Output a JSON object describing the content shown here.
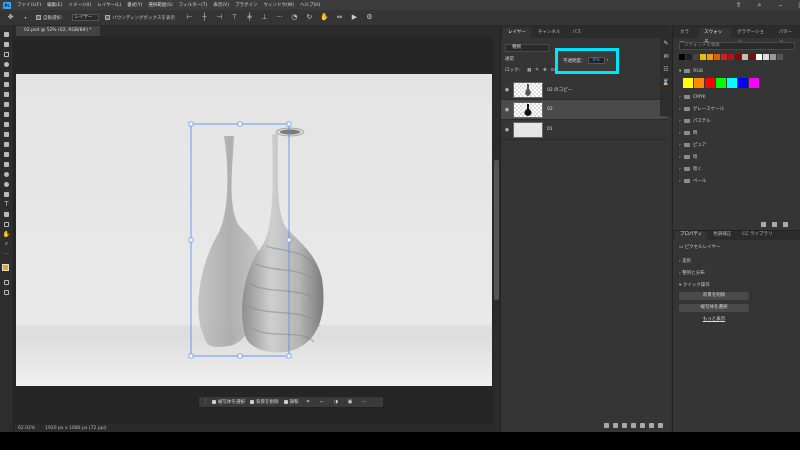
{
  "menubar": {
    "logo": "Ps",
    "items": [
      "ファイル(F)",
      "編集(E)",
      "イメージ(I)",
      "レイヤー(L)",
      "書式(Y)",
      "選択範囲(S)",
      "フィルター(T)",
      "表示(V)",
      "プラグイン",
      "ウィンドウ(W)",
      "ヘルプ(H)"
    ]
  },
  "options": {
    "auto_select_label": "自動選択：",
    "auto_select_target": "レイヤー",
    "bbox_label": "バウンディングボックスを表示"
  },
  "document": {
    "tab_label": "02.psd @ 52% (02, RGB/8#) *",
    "zoom": "62.02%",
    "size_info": "1920 px x 1080 px (72 ppi)"
  },
  "context_bar": {
    "select_subject": "被写体を選択",
    "remove_bg": "背景を削除",
    "adjust": "調和"
  },
  "layers_panel": {
    "tabs": [
      "レイヤー",
      "チャンネル",
      "パス"
    ],
    "kind_label": "種類",
    "blend_mode": "通常",
    "lock_label": "ロック：",
    "opacity_label": "不透明度：",
    "opacity_value": "0%",
    "layers": [
      {
        "name": "02 のコピー",
        "selected": false
      },
      {
        "name": "02",
        "selected": true
      },
      {
        "name": "01",
        "selected": false
      }
    ]
  },
  "swatches_panel": {
    "tabs": [
      "カラー",
      "スウォッチ",
      "グラデーション",
      "パターン"
    ],
    "search_placeholder": "スウォッチを検索",
    "recent_colors": [
      "#000000",
      "#222222",
      "#444444",
      "#f0c000",
      "#f0a000",
      "#e06000",
      "#d02020",
      "#b01818",
      "#900000",
      "#c0c0c0",
      "#7a1010",
      "#ffffff",
      "#dddddd",
      "#999999",
      "#555555"
    ],
    "groups": [
      "RGB",
      "CMYK",
      "グレースケール",
      "パステル",
      "明",
      "ピュア",
      "暗",
      "暗く",
      "ペール"
    ],
    "rgb_colors": [
      "#ffff00",
      "#ff8800",
      "#ff0000",
      "#00ff00",
      "#00ffff",
      "#0000ff",
      "#ff00ff"
    ]
  },
  "properties_panel": {
    "tabs": [
      "プロパティ",
      "色調補正",
      "CC ライブラリ"
    ],
    "layer_type": "ピクセルレイヤー",
    "transform": "変形",
    "align": "整列と分布",
    "quick_actions": "クイック操作",
    "btn_remove_bg": "背景を削除",
    "btn_select_subject": "被写体を選択",
    "link_more": "もっと表示"
  }
}
